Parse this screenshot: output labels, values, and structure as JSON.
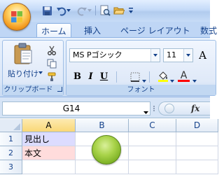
{
  "ribbon": {
    "tabs": [
      {
        "label": "ホーム",
        "active": true
      },
      {
        "label": "挿入",
        "active": false
      },
      {
        "label": "ページ レイアウト",
        "active": false
      },
      {
        "label": "数式",
        "active": false
      }
    ],
    "clipboard": {
      "paste_label": "貼り付け",
      "group_label": "クリップボード"
    },
    "font": {
      "font_name": "MS Pゴシック",
      "font_size": "11",
      "bold": "B",
      "italic": "I",
      "underline": "U",
      "font_color_glyph": "A",
      "grow_font_glyph": "A",
      "group_label": "フォント",
      "highlight_color": "#ffff00",
      "font_color": "#ff0000"
    }
  },
  "formula_bar": {
    "name_box": "G14",
    "fx_label": "fx"
  },
  "sheet": {
    "columns": [
      "A",
      "B",
      "C",
      "D"
    ],
    "selected_column": "A",
    "rows": [
      {
        "number": "1",
        "A": "見出し"
      },
      {
        "number": "2",
        "A": "本文"
      },
      {
        "number": "3",
        "A": ""
      }
    ],
    "fill_colors": {
      "row1": "#dcdcff",
      "row2": "#ffdcdc"
    },
    "shape_color": "#92c83a"
  }
}
